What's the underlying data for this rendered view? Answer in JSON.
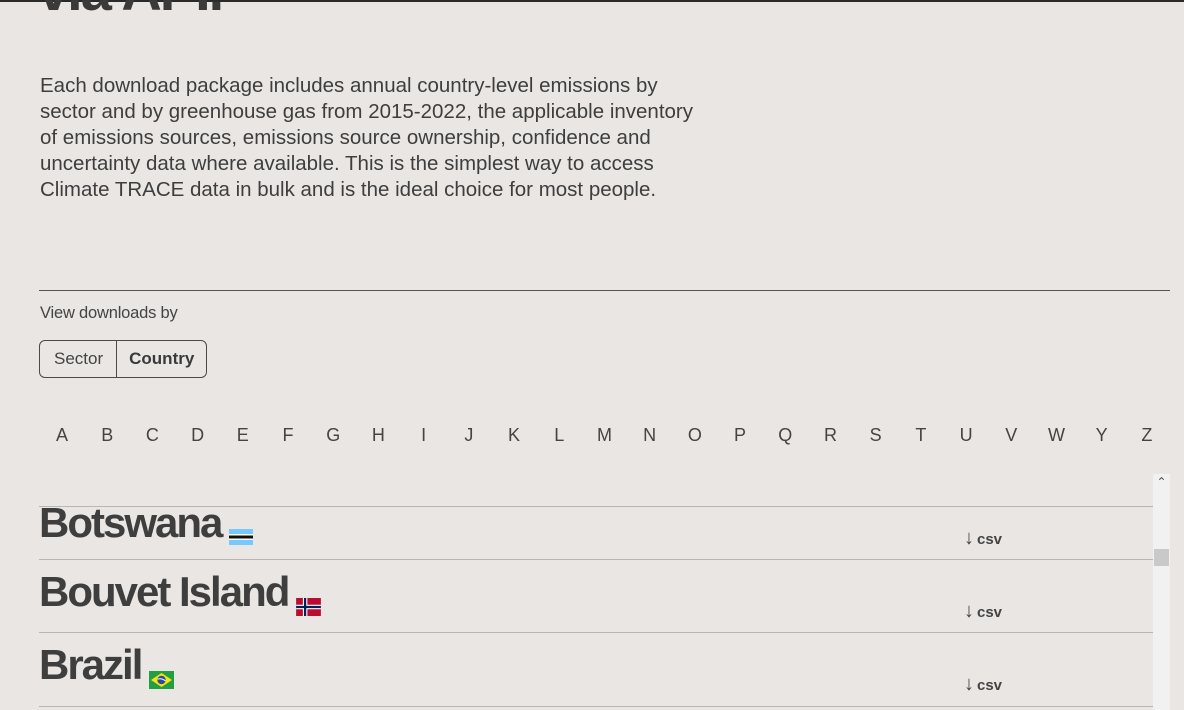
{
  "page": {
    "heading_partial": "via API.",
    "intro": "Each download package includes annual country-level emissions by sector and by greenhouse gas from 2015-2022, the applicable inventory of emissions sources, emissions source ownership, confidence and uncertainty data where available. This is the simplest way to access Climate TRACE data in bulk and is the ideal choice for most people."
  },
  "view": {
    "label": "View downloads by",
    "options": [
      "Sector",
      "Country"
    ],
    "selected": "Country"
  },
  "alphabet": [
    "A",
    "B",
    "C",
    "D",
    "E",
    "F",
    "G",
    "H",
    "I",
    "J",
    "K",
    "L",
    "M",
    "N",
    "O",
    "P",
    "Q",
    "R",
    "S",
    "T",
    "U",
    "V",
    "W",
    "Y",
    "Z"
  ],
  "countries": [
    {
      "name": "Botswana",
      "flag_icon": "botswana-flag-icon",
      "download": "csv"
    },
    {
      "name": "Bouvet Island",
      "flag_icon": "norway-flag-icon",
      "download": "csv"
    },
    {
      "name": "Brazil",
      "flag_icon": "brazil-flag-icon",
      "download": "csv"
    }
  ],
  "scrollbar": {
    "up_icon": "chevron-up-icon"
  }
}
